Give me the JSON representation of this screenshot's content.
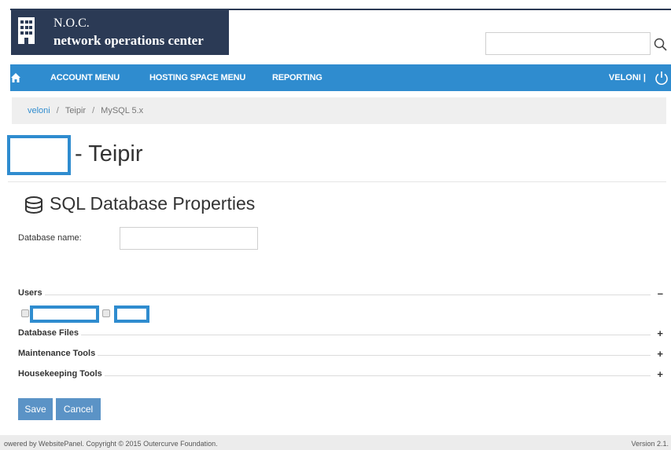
{
  "header": {
    "logo_line1": "N.O.C.",
    "logo_line2": "network operations center",
    "search_placeholder": "",
    "icons": {
      "logo": "building-icon",
      "search": "search-icon"
    }
  },
  "nav": {
    "home_icon": "home-icon",
    "items": [
      "ACCOUNT MENU",
      "HOSTING SPACE MENU",
      "REPORTING"
    ],
    "user": "VELONI |",
    "power_icon": "power-icon"
  },
  "breadcrumb": [
    "veloni",
    "Teipir",
    "MySQL 5.x"
  ],
  "page": {
    "title": "- Teipir",
    "section_title": "SQL Database Properties",
    "section_icon": "database-icon"
  },
  "form": {
    "db_name_label": "Database name:",
    "db_name_value": ""
  },
  "groups": [
    {
      "label": "Users",
      "toggle": "–"
    },
    {
      "label": "Database Files",
      "toggle": "+"
    },
    {
      "label": "Maintenance Tools",
      "toggle": "+"
    },
    {
      "label": "Housekeeping Tools",
      "toggle": "+"
    }
  ],
  "buttons": {
    "save": "Save",
    "cancel": "Cancel"
  },
  "footer": {
    "copyright": "owered by WebsitePanel. Copyright © 2015 Outercurve Foundation.",
    "version": "Version 2.1."
  },
  "colors": {
    "brand": "#2b3a55",
    "accent": "#2f8ccf",
    "button": "#5b93c6"
  }
}
